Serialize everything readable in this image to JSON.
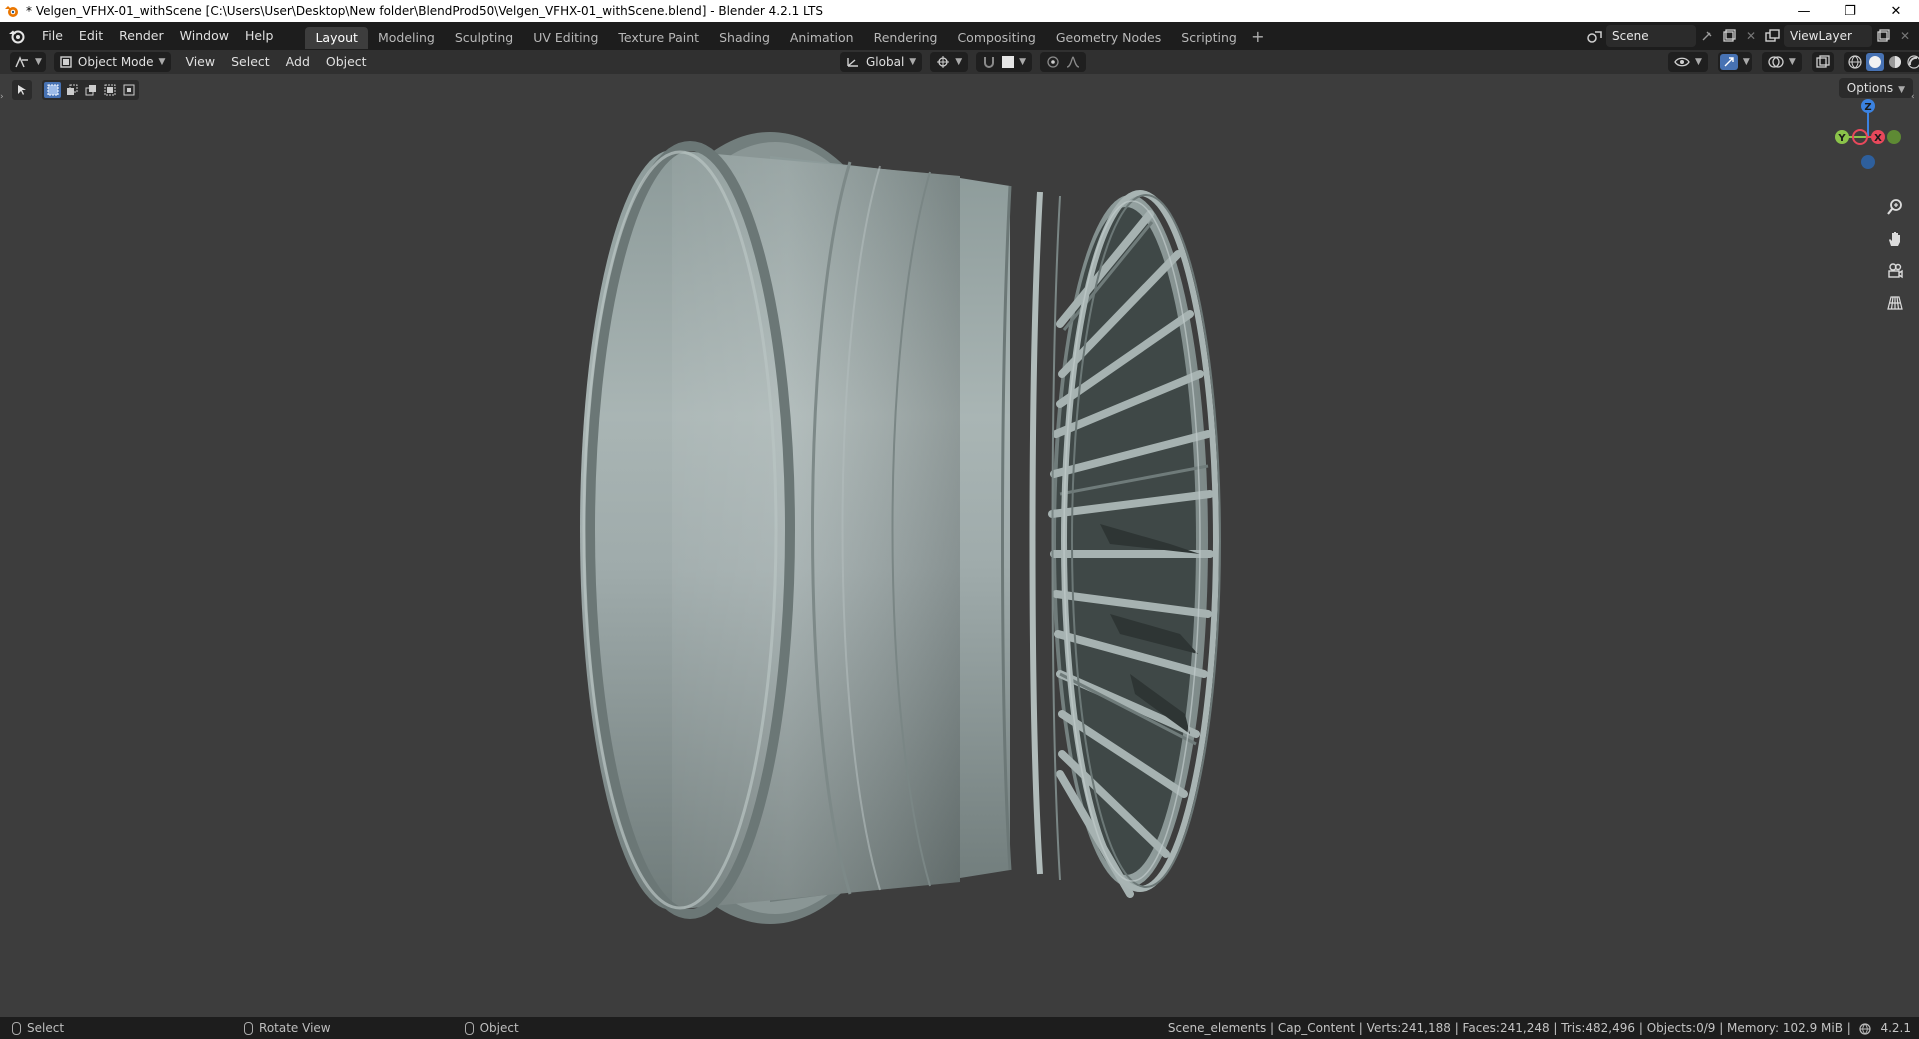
{
  "window": {
    "title": "* Velgen_VFHX-01_withScene [C:\\Users\\User\\Desktop\\New folder\\BlendProd50\\Velgen_VFHX-01_withScene.blend] - Blender 4.2.1 LTS",
    "minimize": "—",
    "maximize": "❐",
    "close": "✕"
  },
  "menu": [
    "File",
    "Edit",
    "Render",
    "Window",
    "Help"
  ],
  "workspaces": [
    "Layout",
    "Modeling",
    "Sculpting",
    "UV Editing",
    "Texture Paint",
    "Shading",
    "Animation",
    "Rendering",
    "Compositing",
    "Geometry Nodes",
    "Scripting"
  ],
  "active_workspace": "Layout",
  "scene": {
    "name": "Scene"
  },
  "view_layer": {
    "name": "ViewLayer"
  },
  "header3d": {
    "mode": "Object Mode",
    "menus": [
      "View",
      "Select",
      "Add",
      "Object"
    ],
    "orientation": "Global",
    "options_label": "Options"
  },
  "gizmo": {
    "z": "Z",
    "y": "Y",
    "x": "X"
  },
  "statusbar": {
    "select": "Select",
    "rotate": "Rotate View",
    "object": "Object",
    "stats": "Scene_elements | Cap_Content | Verts:241,188 | Faces:241,248 | Tris:482,496 | Objects:0/9 | Memory: 102.9 MiB |",
    "version": "4.2.1"
  },
  "colors": {
    "accent": "#4772b3",
    "viewport_bg": "#3d3d3d",
    "x_axis": "#e8485b",
    "y_axis": "#8bc34a",
    "z_axis": "#3b82e0"
  }
}
